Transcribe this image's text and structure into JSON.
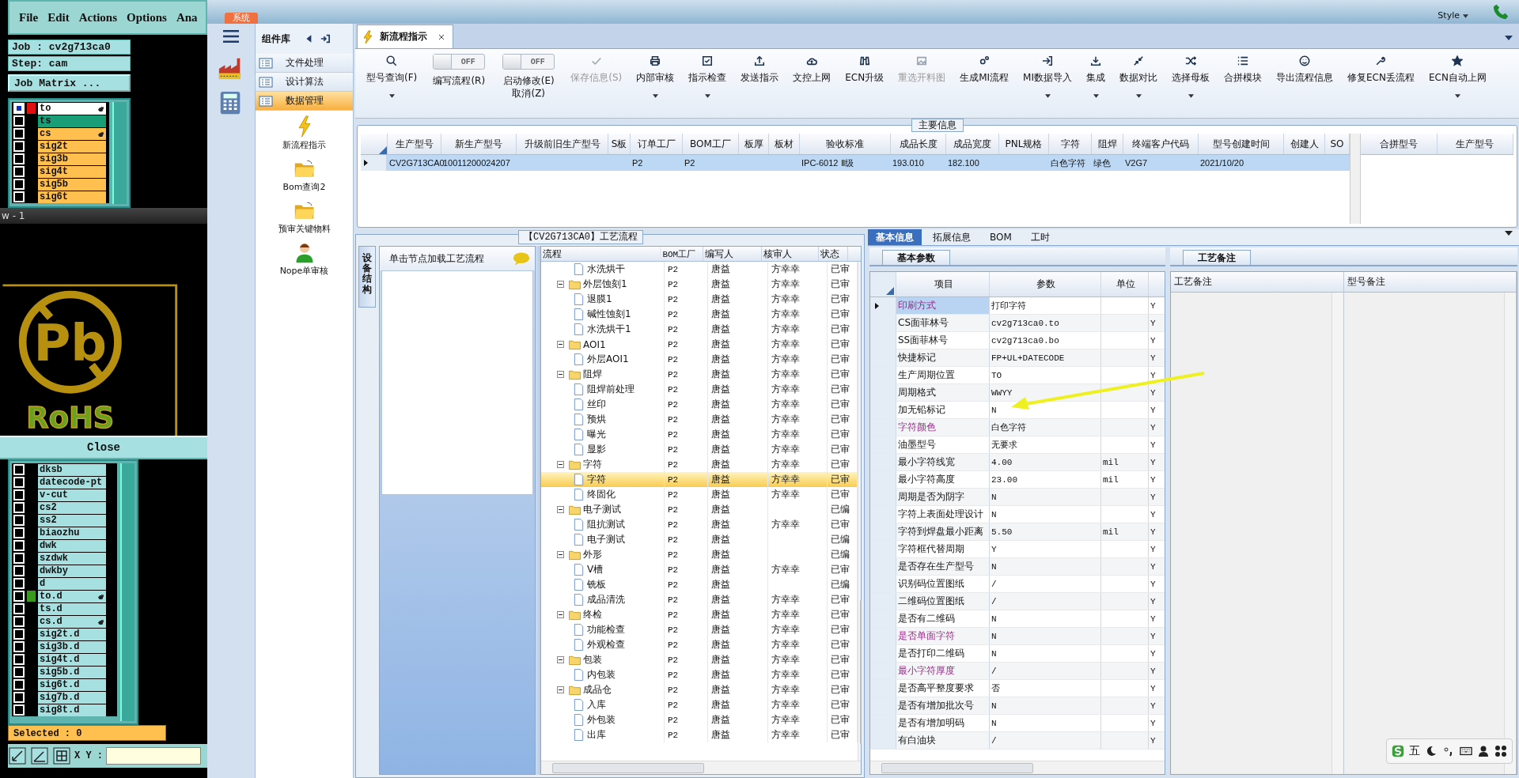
{
  "genesis": {
    "menu": [
      "File",
      "Edit",
      "Actions",
      "Options",
      "Ana"
    ],
    "job": "Job : cv2g713ca0",
    "step": "Step: cam",
    "matrix_button": "Job Matrix ...",
    "layers_top": [
      {
        "name": "to",
        "color": "#ffffff",
        "checked": true,
        "work": true,
        "displayed": false,
        "hand": true
      },
      {
        "name": "ts",
        "color": "#1a9e78",
        "checked": false,
        "work": false,
        "displayed": false,
        "hand": false
      },
      {
        "name": "cs",
        "color": "#ffc050",
        "checked": false,
        "work": false,
        "displayed": false,
        "hand": true
      },
      {
        "name": "sig2t",
        "color": "#ffc050",
        "checked": false,
        "work": false,
        "displayed": false,
        "hand": false
      },
      {
        "name": "sig3b",
        "color": "#ffc050",
        "checked": false,
        "work": false,
        "displayed": false,
        "hand": false
      },
      {
        "name": "sig4t",
        "color": "#ffc050",
        "checked": false,
        "work": false,
        "displayed": false,
        "hand": false
      },
      {
        "name": "sig5b",
        "color": "#ffc050",
        "checked": false,
        "work": false,
        "displayed": false,
        "hand": false
      },
      {
        "name": "sig6t",
        "color": "#ffc050",
        "checked": false,
        "work": false,
        "displayed": false,
        "hand": false
      }
    ],
    "window_title": "w - 1",
    "logo_symbol": "Pb",
    "logo_text": "RoHS",
    "close_button": "Close",
    "layers_bottom": [
      {
        "name": "dksb",
        "color": "#a6e0e0",
        "checked": false,
        "work": false,
        "displayed": false,
        "hand": false
      },
      {
        "name": "datecode-pt",
        "color": "#a6e0e0",
        "checked": false,
        "work": false,
        "displayed": false,
        "hand": false
      },
      {
        "name": "v-cut",
        "color": "#a6e0e0",
        "checked": false,
        "work": false,
        "displayed": false,
        "hand": false
      },
      {
        "name": "cs2",
        "color": "#a6e0e0",
        "checked": false,
        "work": false,
        "displayed": false,
        "hand": false
      },
      {
        "name": "ss2",
        "color": "#a6e0e0",
        "checked": false,
        "work": false,
        "displayed": false,
        "hand": false
      },
      {
        "name": "biaozhu",
        "color": "#a6e0e0",
        "checked": false,
        "work": false,
        "displayed": false,
        "hand": false
      },
      {
        "name": "dwk",
        "color": "#a6e0e0",
        "checked": false,
        "work": false,
        "displayed": false,
        "hand": false
      },
      {
        "name": "szdwk",
        "color": "#a6e0e0",
        "checked": false,
        "work": false,
        "displayed": false,
        "hand": false
      },
      {
        "name": "dwkby",
        "color": "#a6e0e0",
        "checked": false,
        "work": false,
        "displayed": false,
        "hand": false
      },
      {
        "name": "d",
        "color": "#a6e0e0",
        "checked": false,
        "work": false,
        "displayed": false,
        "hand": false
      },
      {
        "name": "to.d",
        "color": "#a6e0e0",
        "checked": false,
        "work": false,
        "displayed": true,
        "hand": true
      },
      {
        "name": "ts.d",
        "color": "#a6e0e0",
        "checked": false,
        "work": false,
        "displayed": false,
        "hand": false
      },
      {
        "name": "cs.d",
        "color": "#a6e0e0",
        "checked": false,
        "work": false,
        "displayed": false,
        "hand": true
      },
      {
        "name": "sig2t.d",
        "color": "#a6e0e0",
        "checked": false,
        "work": false,
        "displayed": false,
        "hand": false
      },
      {
        "name": "sig3b.d",
        "color": "#a6e0e0",
        "checked": false,
        "work": false,
        "displayed": false,
        "hand": false
      },
      {
        "name": "sig4t.d",
        "color": "#a6e0e0",
        "checked": false,
        "work": false,
        "displayed": false,
        "hand": false
      },
      {
        "name": "sig5b.d",
        "color": "#a6e0e0",
        "checked": false,
        "work": false,
        "displayed": false,
        "hand": false
      },
      {
        "name": "sig6t.d",
        "color": "#a6e0e0",
        "checked": false,
        "work": false,
        "displayed": false,
        "hand": false
      },
      {
        "name": "sig7b.d",
        "color": "#a6e0e0",
        "checked": false,
        "work": false,
        "displayed": false,
        "hand": false
      },
      {
        "name": "sig8t.d",
        "color": "#a6e0e0",
        "checked": false,
        "work": false,
        "displayed": false,
        "hand": false
      }
    ],
    "selected_label": "Selected : 0",
    "xy_label": "X Y :"
  },
  "app": {
    "system_button": "系统",
    "style_menu": "Style"
  },
  "component_library": {
    "title": "组件库",
    "categories": [
      {
        "label": "文件处理",
        "selected": false
      },
      {
        "label": "设计算法",
        "selected": false
      },
      {
        "label": "数据管理",
        "selected": true
      }
    ],
    "components": [
      {
        "label": "新流程指示",
        "kind": "lightning"
      },
      {
        "label": "Bom查询2",
        "kind": "folder"
      },
      {
        "label": "预审关键物料",
        "kind": "folder"
      },
      {
        "label": "Nope单审核",
        "kind": "user"
      }
    ]
  },
  "tabs": [
    {
      "label": "新流程指示",
      "selected": true
    }
  ],
  "toolbar": [
    {
      "kind": "button",
      "label": "型号查询(F)",
      "dropdown": true,
      "disabled": false
    },
    {
      "kind": "toggle",
      "label": "编写流程(R)",
      "state_label": "OFF",
      "on": false
    },
    {
      "kind": "toggle",
      "label": "启动修改(E)",
      "label_2": "取消(Z)",
      "state_label": "OFF",
      "on": false
    },
    {
      "kind": "button",
      "label": "保存信息(S)",
      "dropdown": false,
      "disabled": true
    },
    {
      "kind": "button",
      "label": "内部审核",
      "dropdown": true,
      "disabled": false
    },
    {
      "kind": "button",
      "label": "指示检查",
      "dropdown": true,
      "disabled": false
    },
    {
      "kind": "button",
      "label": "发送指示",
      "dropdown": false,
      "disabled": false
    },
    {
      "kind": "button",
      "label": "文控上网",
      "dropdown": false,
      "disabled": false
    },
    {
      "kind": "button",
      "label": "ECN升级",
      "dropdown": false,
      "disabled": false
    },
    {
      "kind": "button",
      "label": "重选开料图",
      "dropdown": false,
      "disabled": true
    },
    {
      "kind": "button",
      "label": "生成MI流程",
      "dropdown": false,
      "disabled": false
    },
    {
      "kind": "button",
      "label": "MI数据导入",
      "dropdown": true,
      "disabled": false
    },
    {
      "kind": "button",
      "label": "集成",
      "dropdown": true,
      "disabled": false
    },
    {
      "kind": "button",
      "label": "数据对比",
      "dropdown": true,
      "disabled": false
    },
    {
      "kind": "button",
      "label": "选择母板",
      "dropdown": true,
      "disabled": false
    },
    {
      "kind": "button",
      "label": "合拼模块",
      "dropdown": false,
      "disabled": false
    },
    {
      "kind": "button",
      "label": "导出流程信息",
      "dropdown": false,
      "disabled": false
    },
    {
      "kind": "button",
      "label": "修复ECN丢流程",
      "dropdown": false,
      "disabled": false
    },
    {
      "kind": "button",
      "label": "ECN自动上网",
      "dropdown": true,
      "disabled": false
    }
  ],
  "main_info": {
    "title": "主要信息",
    "columns": [
      "生产型号",
      "新生产型号",
      "升级前旧生产型号",
      "S板",
      "订单工厂",
      "BOM工厂",
      "板厚",
      "板材",
      "验收标准",
      "成品长度",
      "成品宽度",
      "PNL规格",
      "字符",
      "阻焊",
      "终端客户代码",
      "型号创建时间",
      "创建人",
      "SO"
    ],
    "rows": [
      {
        "selected": true,
        "cells": [
          "CV2G713CA0",
          "10011200024207",
          null,
          null,
          "P2",
          "P2",
          null,
          null,
          "IPC-6012 Ⅱ级",
          "193.010",
          "182.100",
          null,
          "白色字符",
          "绿色",
          "V2G7",
          "2021/10/20",
          null,
          null
        ]
      }
    ],
    "side_columns": [
      "合拼型号",
      "生产型号"
    ]
  },
  "process": {
    "title": "【CV2G713CA0】工艺流程",
    "side_tab": "设备结构",
    "hint": "单击节点加载工艺流程",
    "columns": [
      "流程",
      "BOM工厂",
      "编写人",
      "核审人",
      "状态"
    ],
    "tree": [
      {
        "kind": "step",
        "name": "水洗烘干",
        "factory": "P2",
        "writer": "唐益",
        "reviewer": "方幸幸",
        "status": "已审",
        "selected": false
      },
      {
        "kind": "folder",
        "name": "外层蚀刻1",
        "factory": "P2",
        "writer": "唐益",
        "reviewer": "方幸幸",
        "status": "已审",
        "selected": false,
        "expanded": true,
        "children": [
          {
            "kind": "step",
            "name": "退膜1",
            "factory": "P2",
            "writer": "唐益",
            "reviewer": "方幸幸",
            "status": "已审",
            "selected": false
          },
          {
            "kind": "step",
            "name": "碱性蚀刻1",
            "factory": "P2",
            "writer": "唐益",
            "reviewer": "方幸幸",
            "status": "已审",
            "selected": false
          },
          {
            "kind": "step",
            "name": "水洗烘干1",
            "factory": "P2",
            "writer": "唐益",
            "reviewer": "方幸幸",
            "status": "已审",
            "selected": false
          }
        ]
      },
      {
        "kind": "folder",
        "name": "AOI1",
        "factory": "P2",
        "writer": "唐益",
        "reviewer": "方幸幸",
        "status": "已审",
        "selected": false,
        "expanded": true,
        "children": [
          {
            "kind": "step",
            "name": "外层AOI1",
            "factory": "P2",
            "writer": "唐益",
            "reviewer": "方幸幸",
            "status": "已审",
            "selected": false
          }
        ]
      },
      {
        "kind": "folder",
        "name": "阻焊",
        "factory": "P2",
        "writer": "唐益",
        "reviewer": "方幸幸",
        "status": "已审",
        "selected": false,
        "expanded": true,
        "children": [
          {
            "kind": "step",
            "name": "阻焊前处理",
            "factory": "P2",
            "writer": "唐益",
            "reviewer": "方幸幸",
            "status": "已审",
            "selected": false
          },
          {
            "kind": "step",
            "name": "丝印",
            "factory": "P2",
            "writer": "唐益",
            "reviewer": "方幸幸",
            "status": "已审",
            "selected": false
          },
          {
            "kind": "step",
            "name": "预烘",
            "factory": "P2",
            "writer": "唐益",
            "reviewer": "方幸幸",
            "status": "已审",
            "selected": false
          },
          {
            "kind": "step",
            "name": "曝光",
            "factory": "P2",
            "writer": "唐益",
            "reviewer": "方幸幸",
            "status": "已审",
            "selected": false
          },
          {
            "kind": "step",
            "name": "显影",
            "factory": "P2",
            "writer": "唐益",
            "reviewer": "方幸幸",
            "status": "已审",
            "selected": false
          }
        ]
      },
      {
        "kind": "folder",
        "name": "字符",
        "factory": "P2",
        "writer": "唐益",
        "reviewer": "方幸幸",
        "status": "已审",
        "selected": false,
        "expanded": true,
        "children": [
          {
            "kind": "step",
            "name": "字符",
            "factory": "P2",
            "writer": "唐益",
            "reviewer": "方幸幸",
            "status": "已审",
            "selected": true
          },
          {
            "kind": "step",
            "name": "终固化",
            "factory": "P2",
            "writer": "唐益",
            "reviewer": "方幸幸",
            "status": "已审",
            "selected": false
          }
        ]
      },
      {
        "kind": "folder",
        "name": "电子测试",
        "factory": "P2",
        "writer": "唐益",
        "status": "已编",
        "selected": false,
        "expanded": true,
        "children": [
          {
            "kind": "step",
            "name": "阻抗测试",
            "factory": "P2",
            "writer": "唐益",
            "reviewer": "方幸幸",
            "status": "已审",
            "selected": false
          },
          {
            "kind": "step",
            "name": "电子测试",
            "factory": "P2",
            "writer": "唐益",
            "status": "已编",
            "selected": false
          }
        ]
      },
      {
        "kind": "folder",
        "name": "外形",
        "factory": "P2",
        "writer": "唐益",
        "status": "已编",
        "selected": false,
        "expanded": true,
        "children": [
          {
            "kind": "step",
            "name": "V槽",
            "factory": "P2",
            "writer": "唐益",
            "reviewer": "方幸幸",
            "status": "已审",
            "selected": false
          },
          {
            "kind": "step",
            "name": "铣板",
            "factory": "P2",
            "writer": "唐益",
            "status": "已编",
            "selected": false
          },
          {
            "kind": "step",
            "name": "成品清洗",
            "factory": "P2",
            "writer": "唐益",
            "reviewer": "方幸幸",
            "status": "已审",
            "selected": false
          }
        ]
      },
      {
        "kind": "folder",
        "name": "终检",
        "factory": "P2",
        "writer": "唐益",
        "reviewer": "方幸幸",
        "status": "已审",
        "selected": false,
        "expanded": true,
        "children": [
          {
            "kind": "step",
            "name": "功能检查",
            "factory": "P2",
            "writer": "唐益",
            "reviewer": "方幸幸",
            "status": "已审",
            "selected": false
          },
          {
            "kind": "step",
            "name": "外观检查",
            "factory": "P2",
            "writer": "唐益",
            "reviewer": "方幸幸",
            "status": "已审",
            "selected": false
          }
        ]
      },
      {
        "kind": "folder",
        "name": "包装",
        "factory": "P2",
        "writer": "唐益",
        "reviewer": "方幸幸",
        "status": "已审",
        "selected": false,
        "expanded": true,
        "children": [
          {
            "kind": "step",
            "name": "内包装",
            "factory": "P2",
            "writer": "唐益",
            "reviewer": "方幸幸",
            "status": "已审",
            "selected": false
          }
        ]
      },
      {
        "kind": "folder",
        "name": "成品仓",
        "factory": "P2",
        "writer": "唐益",
        "reviewer": "方幸幸",
        "status": "已审",
        "selected": false,
        "expanded": true,
        "children": [
          {
            "kind": "step",
            "name": "入库",
            "factory": "P2",
            "writer": "唐益",
            "reviewer": "方幸幸",
            "status": "已审",
            "selected": false
          },
          {
            "kind": "step",
            "name": "外包装",
            "factory": "P2",
            "writer": "唐益",
            "reviewer": "方幸幸",
            "status": "已审",
            "selected": false
          },
          {
            "kind": "step",
            "name": "出库",
            "factory": "P2",
            "writer": "唐益",
            "reviewer": "方幸幸",
            "status": "已审",
            "selected": false
          }
        ]
      }
    ]
  },
  "params": {
    "tabs": [
      {
        "label": "基本信息",
        "selected": true
      },
      {
        "label": "拓展信息",
        "selected": false
      },
      {
        "label": "BOM",
        "selected": false
      },
      {
        "label": "工时",
        "selected": false
      }
    ],
    "subtab": "基本参数",
    "columns": [
      "项目",
      "参数",
      "单位"
    ],
    "rows": [
      {
        "item": "印刷方式",
        "value": "打印字符",
        "flag": "Y",
        "highlight": true,
        "selected": true
      },
      {
        "item": "CS面菲林号",
        "value": "cv2g713ca0.to",
        "flag": "Y",
        "highlight": false,
        "selected": false
      },
      {
        "item": "SS面菲林号",
        "value": "cv2g713ca0.bo",
        "flag": "Y",
        "highlight": false,
        "selected": false
      },
      {
        "item": "快捷标记",
        "value": "FP+UL+DATECODE",
        "flag": "Y",
        "highlight": false,
        "selected": false
      },
      {
        "item": "生产周期位置",
        "value": "TO",
        "flag": "Y",
        "highlight": false,
        "selected": false
      },
      {
        "item": "周期格式",
        "value": "WWYY",
        "flag": "Y",
        "highlight": false,
        "selected": false
      },
      {
        "item": "加无铅标记",
        "value": "N",
        "flag": "Y",
        "highlight": false,
        "selected": false
      },
      {
        "item": "字符颜色",
        "value": "白色字符",
        "flag": "Y",
        "highlight": true,
        "selected": false
      },
      {
        "item": "油墨型号",
        "value": "无要求",
        "flag": "Y",
        "highlight": false,
        "selected": false
      },
      {
        "item": "最小字符线宽",
        "value": "4.00",
        "unit": "mil",
        "flag": "Y",
        "highlight": false,
        "selected": false
      },
      {
        "item": "最小字符高度",
        "value": "23.00",
        "unit": "mil",
        "flag": "Y",
        "highlight": false,
        "selected": false
      },
      {
        "item": "周期是否为阴字",
        "value": "N",
        "flag": "Y",
        "highlight": false,
        "selected": false
      },
      {
        "item": "字符上表面处理设计",
        "value": "N",
        "flag": "Y",
        "highlight": false,
        "selected": false
      },
      {
        "item": "字符到焊盘最小距离",
        "value": "5.50",
        "unit": "mil",
        "flag": "Y",
        "highlight": false,
        "selected": false
      },
      {
        "item": "字符框代替周期",
        "value": "Y",
        "flag": "Y",
        "highlight": false,
        "selected": false
      },
      {
        "item": "是否存在生产型号",
        "value": "N",
        "flag": "Y",
        "highlight": false,
        "selected": false
      },
      {
        "item": "识别码位置图纸",
        "value": "/",
        "flag": "Y",
        "highlight": false,
        "selected": false
      },
      {
        "item": "二维码位置图纸",
        "value": "/",
        "flag": "Y",
        "highlight": false,
        "selected": false
      },
      {
        "item": "是否有二维码",
        "value": "N",
        "flag": "Y",
        "highlight": false,
        "selected": false
      },
      {
        "item": "是否单面字符",
        "value": "N",
        "flag": "Y",
        "highlight": true,
        "selected": false
      },
      {
        "item": "是否打印二维码",
        "value": "N",
        "flag": "Y",
        "highlight": false,
        "selected": false
      },
      {
        "item": "最小字符厚度",
        "value": "/",
        "flag": "Y",
        "highlight": true,
        "selected": false
      },
      {
        "item": "是否高平整度要求",
        "value": "否",
        "flag": "Y",
        "highlight": false,
        "selected": false
      },
      {
        "item": "是否有增加批次号",
        "value": "N",
        "flag": "Y",
        "highlight": false,
        "selected": false
      },
      {
        "item": "是否有增加明码",
        "value": "N",
        "flag": "Y",
        "highlight": false,
        "selected": false
      },
      {
        "item": "有白油块",
        "value": "/",
        "flag": "Y",
        "highlight": false,
        "selected": false
      }
    ]
  },
  "remarks": {
    "tab": "工艺备注",
    "columns": [
      "工艺备注",
      "型号备注"
    ]
  },
  "ime": {
    "mode": "五"
  }
}
